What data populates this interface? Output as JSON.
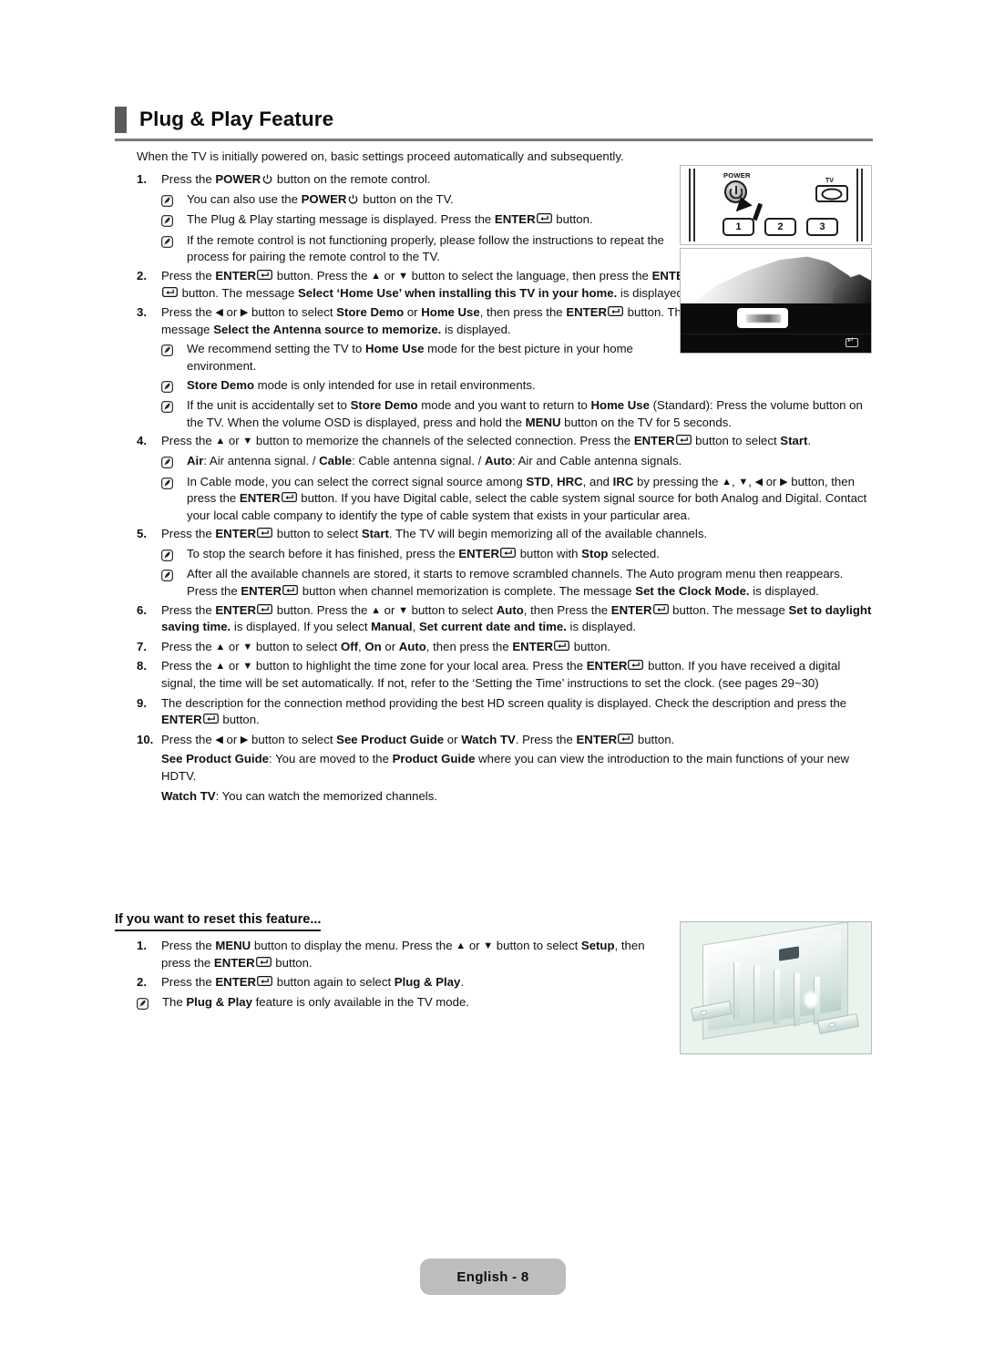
{
  "page": {
    "title": "Plug & Play Feature",
    "footer_label": "English - 8",
    "accent_bar_color": "#5a5a5a",
    "rule_color": "#7c7c7c",
    "footer_bg_color": "#bdbdbd"
  },
  "intro": "When the TV is initially powered on, basic settings proceed automatically and subsequently.",
  "steps": [
    {
      "num": "1.",
      "text_html": "Press the <b>POWER</b><span class=\"ico power-ico\" data-name=\"power-icon\"></span> button on the remote control.",
      "notes": [
        "You can also use the <b>POWER</b><span class=\"ico power-ico\" data-name=\"power-icon\"></span> button on the TV.",
        "The Plug &amp; Play starting message is displayed. Press the <b>ENTER</b><span class=\"ico enter-ico\" data-name=\"enter-icon\"></span> button.",
        "If the remote control is not functioning properly, please follow the instructions to repeat the process for pairing the remote control to the TV."
      ]
    },
    {
      "num": "2.",
      "text_html": "Press the <b>ENTER</b><span class=\"ico enter-ico\" data-name=\"enter-icon\"></span> button. Press the <span class=\"arrow-gl\">▲</span> or <span class=\"arrow-gl\">▼</span> button to select the language, then press the <b>ENTER</b><span class=\"ico enter-ico\" data-name=\"enter-icon\"></span> button. The message <b>Select ‘Home Use’ when installing this TV in your home.</b> is displayed.",
      "notes": []
    },
    {
      "num": "3.",
      "text_html": "Press the <span class=\"arrow-gl\">◀</span> or <span class=\"arrow-gl\">▶</span> button to select <b>Store Demo</b> or <b>Home Use</b>, then press the <b>ENTER</b><span class=\"ico enter-ico\" data-name=\"enter-icon\"></span> button. The message <b>Select the Antenna source to memorize.</b> is displayed.",
      "notes": [
        "We recommend setting the TV to <b>Home Use</b> mode for the best picture in your home environment.",
        "<b>Store Demo</b> mode is only intended for use in retail environments.",
        "If the unit is accidentally set to <b>Store Demo</b> mode and you want to return to <b>Home Use</b> (Standard): Press the volume button on the TV. When the volume OSD is displayed, press and hold the <b>MENU</b> button on the TV for 5 seconds."
      ]
    },
    {
      "num": "4.",
      "text_html": "Press the <span class=\"arrow-gl\">▲</span> or <span class=\"arrow-gl\">▼</span> button to memorize the channels of the selected connection. Press the <b>ENTER</b><span class=\"ico enter-ico\" data-name=\"enter-icon\"></span> button to select <b>Start</b>.",
      "notes": [
        "<b>Air</b>: Air antenna signal. / <b>Cable</b>: Cable antenna signal. / <b>Auto</b>: Air and Cable antenna signals.",
        "In Cable mode, you can select the correct signal source among <b>STD</b>, <b>HRC</b>, and <b>IRC</b> by pressing the <span class=\"arrow-gl\">▲</span>, <span class=\"arrow-gl\">▼</span>, <span class=\"arrow-gl\">◀</span> or <span class=\"arrow-gl\">▶</span> button, then press the <b>ENTER</b><span class=\"ico enter-ico\" data-name=\"enter-icon\"></span> button. If you have Digital cable, select the cable system signal source for both Analog and Digital. Contact your local cable company to identify the type of cable system that exists in your particular area."
      ]
    },
    {
      "num": "5.",
      "text_html": "Press the <b>ENTER</b><span class=\"ico enter-ico\" data-name=\"enter-icon\"></span> button to select <b>Start</b>. The TV will begin memorizing all of the available channels.",
      "notes": [
        "To stop the search before it has finished, press the <b>ENTER</b><span class=\"ico enter-ico\" data-name=\"enter-icon\"></span> button with <b>Stop</b> selected.",
        "After all the available channels are stored, it starts to remove scrambled channels. The Auto program menu then reappears. Press the <b>ENTER</b><span class=\"ico enter-ico\" data-name=\"enter-icon\"></span> button when channel memorization is complete. The message <b>Set the Clock Mode.</b> is displayed."
      ]
    },
    {
      "num": "6.",
      "text_html": "Press the <b>ENTER</b><span class=\"ico enter-ico\" data-name=\"enter-icon\"></span> button. Press the <span class=\"arrow-gl\">▲</span> or <span class=\"arrow-gl\">▼</span> button to select <b>Auto</b>, then Press the <b>ENTER</b><span class=\"ico enter-ico\" data-name=\"enter-icon\"></span> button. The message <b>Set to daylight saving time.</b> is displayed. If you select <b>Manual</b>, <b>Set current date and time.</b> is displayed.",
      "notes": []
    },
    {
      "num": "7.",
      "text_html": "Press the <span class=\"arrow-gl\">▲</span> or <span class=\"arrow-gl\">▼</span> button to select <b>Off</b>, <b>On</b> or <b>Auto</b>, then press the <b>ENTER</b><span class=\"ico enter-ico\" data-name=\"enter-icon\"></span> button.",
      "notes": []
    },
    {
      "num": "8.",
      "text_html": "Press the <span class=\"arrow-gl\">▲</span> or <span class=\"arrow-gl\">▼</span> button to highlight the time zone for your local area. Press the <b>ENTER</b><span class=\"ico enter-ico\" data-name=\"enter-icon\"></span> button. If you have received a digital signal, the time will be set automatically. If not, refer to the ‘Setting the Time’ instructions to set the clock. (see pages 29~30)",
      "notes": []
    },
    {
      "num": "9.",
      "text_html": "The description for the connection method providing the best HD screen quality is displayed. Check the description and press the <b>ENTER</b><span class=\"ico enter-ico\" data-name=\"enter-icon\"></span> button.",
      "notes": []
    },
    {
      "num": "10.",
      "text_html": "Press the <span class=\"arrow-gl\">◀</span> or <span class=\"arrow-gl\">▶</span> button to select <b>See Product Guide</b> or <b>Watch TV</b>. Press the <b>ENTER</b><span class=\"ico enter-ico\" data-name=\"enter-icon\"></span> button.",
      "notes": [],
      "sub_paragraphs": [
        "<b>See Product Guide</b>: You are moved to the <b>Product Guide</b> where you can view the introduction to the main functions of your new HDTV.",
        "<b>Watch TV</b>: You can watch the memorized channels."
      ]
    }
  ],
  "reset_section": {
    "heading": "If you want to reset this feature...",
    "steps": [
      {
        "num": "1.",
        "text_html": "Press the <b>MENU</b> button to display the menu. Press the <span class=\"arrow-gl\">▲</span> or <span class=\"arrow-gl\">▼</span> button to select <b>Setup</b>, then press the <b>ENTER</b><span class=\"ico enter-ico\" data-name=\"enter-icon\"></span> button."
      },
      {
        "num": "2.",
        "text_html": "Press the <b>ENTER</b><span class=\"ico enter-ico\" data-name=\"enter-icon\"></span> button again to select <b>Plug &amp; Play</b>."
      }
    ],
    "note": "The <b>Plug &amp; Play</b> feature is only available in the TV mode."
  },
  "figures": {
    "remote": {
      "power_label": "POWER",
      "tv_label": "TV",
      "number_buttons": [
        "1",
        "2",
        "3"
      ]
    },
    "osd": {
      "caption": ""
    },
    "stand": {
      "caption": ""
    }
  }
}
